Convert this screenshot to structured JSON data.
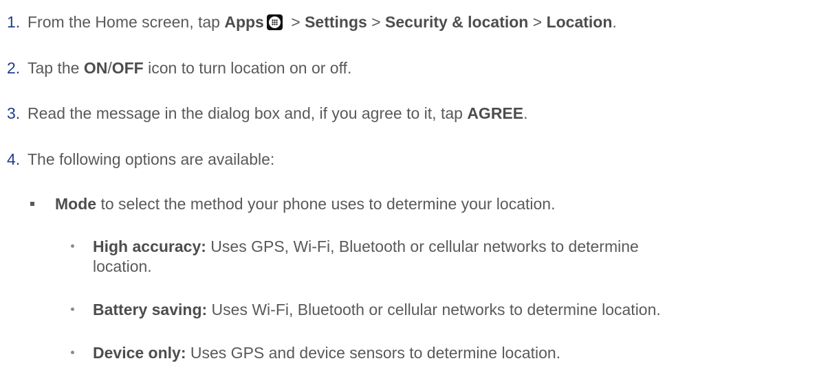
{
  "steps": [
    {
      "number": "1.",
      "t1": "From the Home screen, tap ",
      "apps": "Apps",
      "apps_icon": "apps-grid-icon",
      "sep1": " > ",
      "settings": "Settings",
      "sep2": " > ",
      "security": "Security & location",
      "sep3": " > ",
      "location": "Location",
      "end": "."
    },
    {
      "number": "2.",
      "t1": "Tap the ",
      "on": "ON",
      "slash": "/",
      "off": "OFF",
      "t2": " icon to turn location on or off."
    },
    {
      "number": "3.",
      "t1": "Read the message in the dialog box and, if you agree to it, tap ",
      "agree": "AGREE",
      "end": "."
    },
    {
      "number": "4.",
      "t1": "The following options are available:"
    }
  ],
  "mode": {
    "label": "Mode",
    "text": " to select the method your phone uses to determine your location."
  },
  "options": [
    {
      "label": "High accuracy:",
      "line1": " Uses GPS, Wi-Fi, Bluetooth or cellular networks to determine",
      "line2": "location."
    },
    {
      "label": "Battery saving:",
      "line1": " Uses Wi-Fi, Bluetooth or cellular networks to determine location."
    },
    {
      "label": "Device only:",
      "line1": " Uses GPS and device sensors to determine location."
    }
  ],
  "colors": {
    "number": "#1f3d8c",
    "text": "#595959"
  }
}
